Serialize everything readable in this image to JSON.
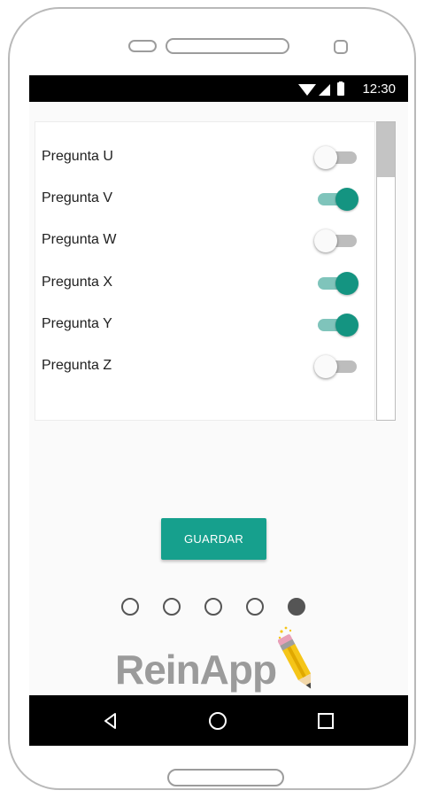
{
  "status_bar": {
    "time": "12:30",
    "icons": [
      "wifi-icon",
      "cell-signal-icon",
      "battery-icon"
    ]
  },
  "questions": [
    {
      "label": "Pregunta U",
      "checked": false
    },
    {
      "label": "Pregunta V",
      "checked": true
    },
    {
      "label": "Pregunta W",
      "checked": false
    },
    {
      "label": "Pregunta X",
      "checked": true
    },
    {
      "label": "Pregunta Y",
      "checked": true
    },
    {
      "label": "Pregunta Z",
      "checked": false
    }
  ],
  "save_button": {
    "label": "GUARDAR"
  },
  "pager": {
    "total": 5,
    "active_index": 4
  },
  "logo": {
    "text": "ReinApp"
  },
  "nav_bar": {
    "icons": [
      "back-icon",
      "home-icon",
      "recents-icon"
    ]
  },
  "colors": {
    "accent": "#16a08d",
    "switch_on_thumb": "#149481",
    "switch_on_track": "#7fc4bb",
    "switch_off_track": "#bdbdbd",
    "logo_gray": "#9b9b9b",
    "pencil_yellow": "#f5c518"
  }
}
